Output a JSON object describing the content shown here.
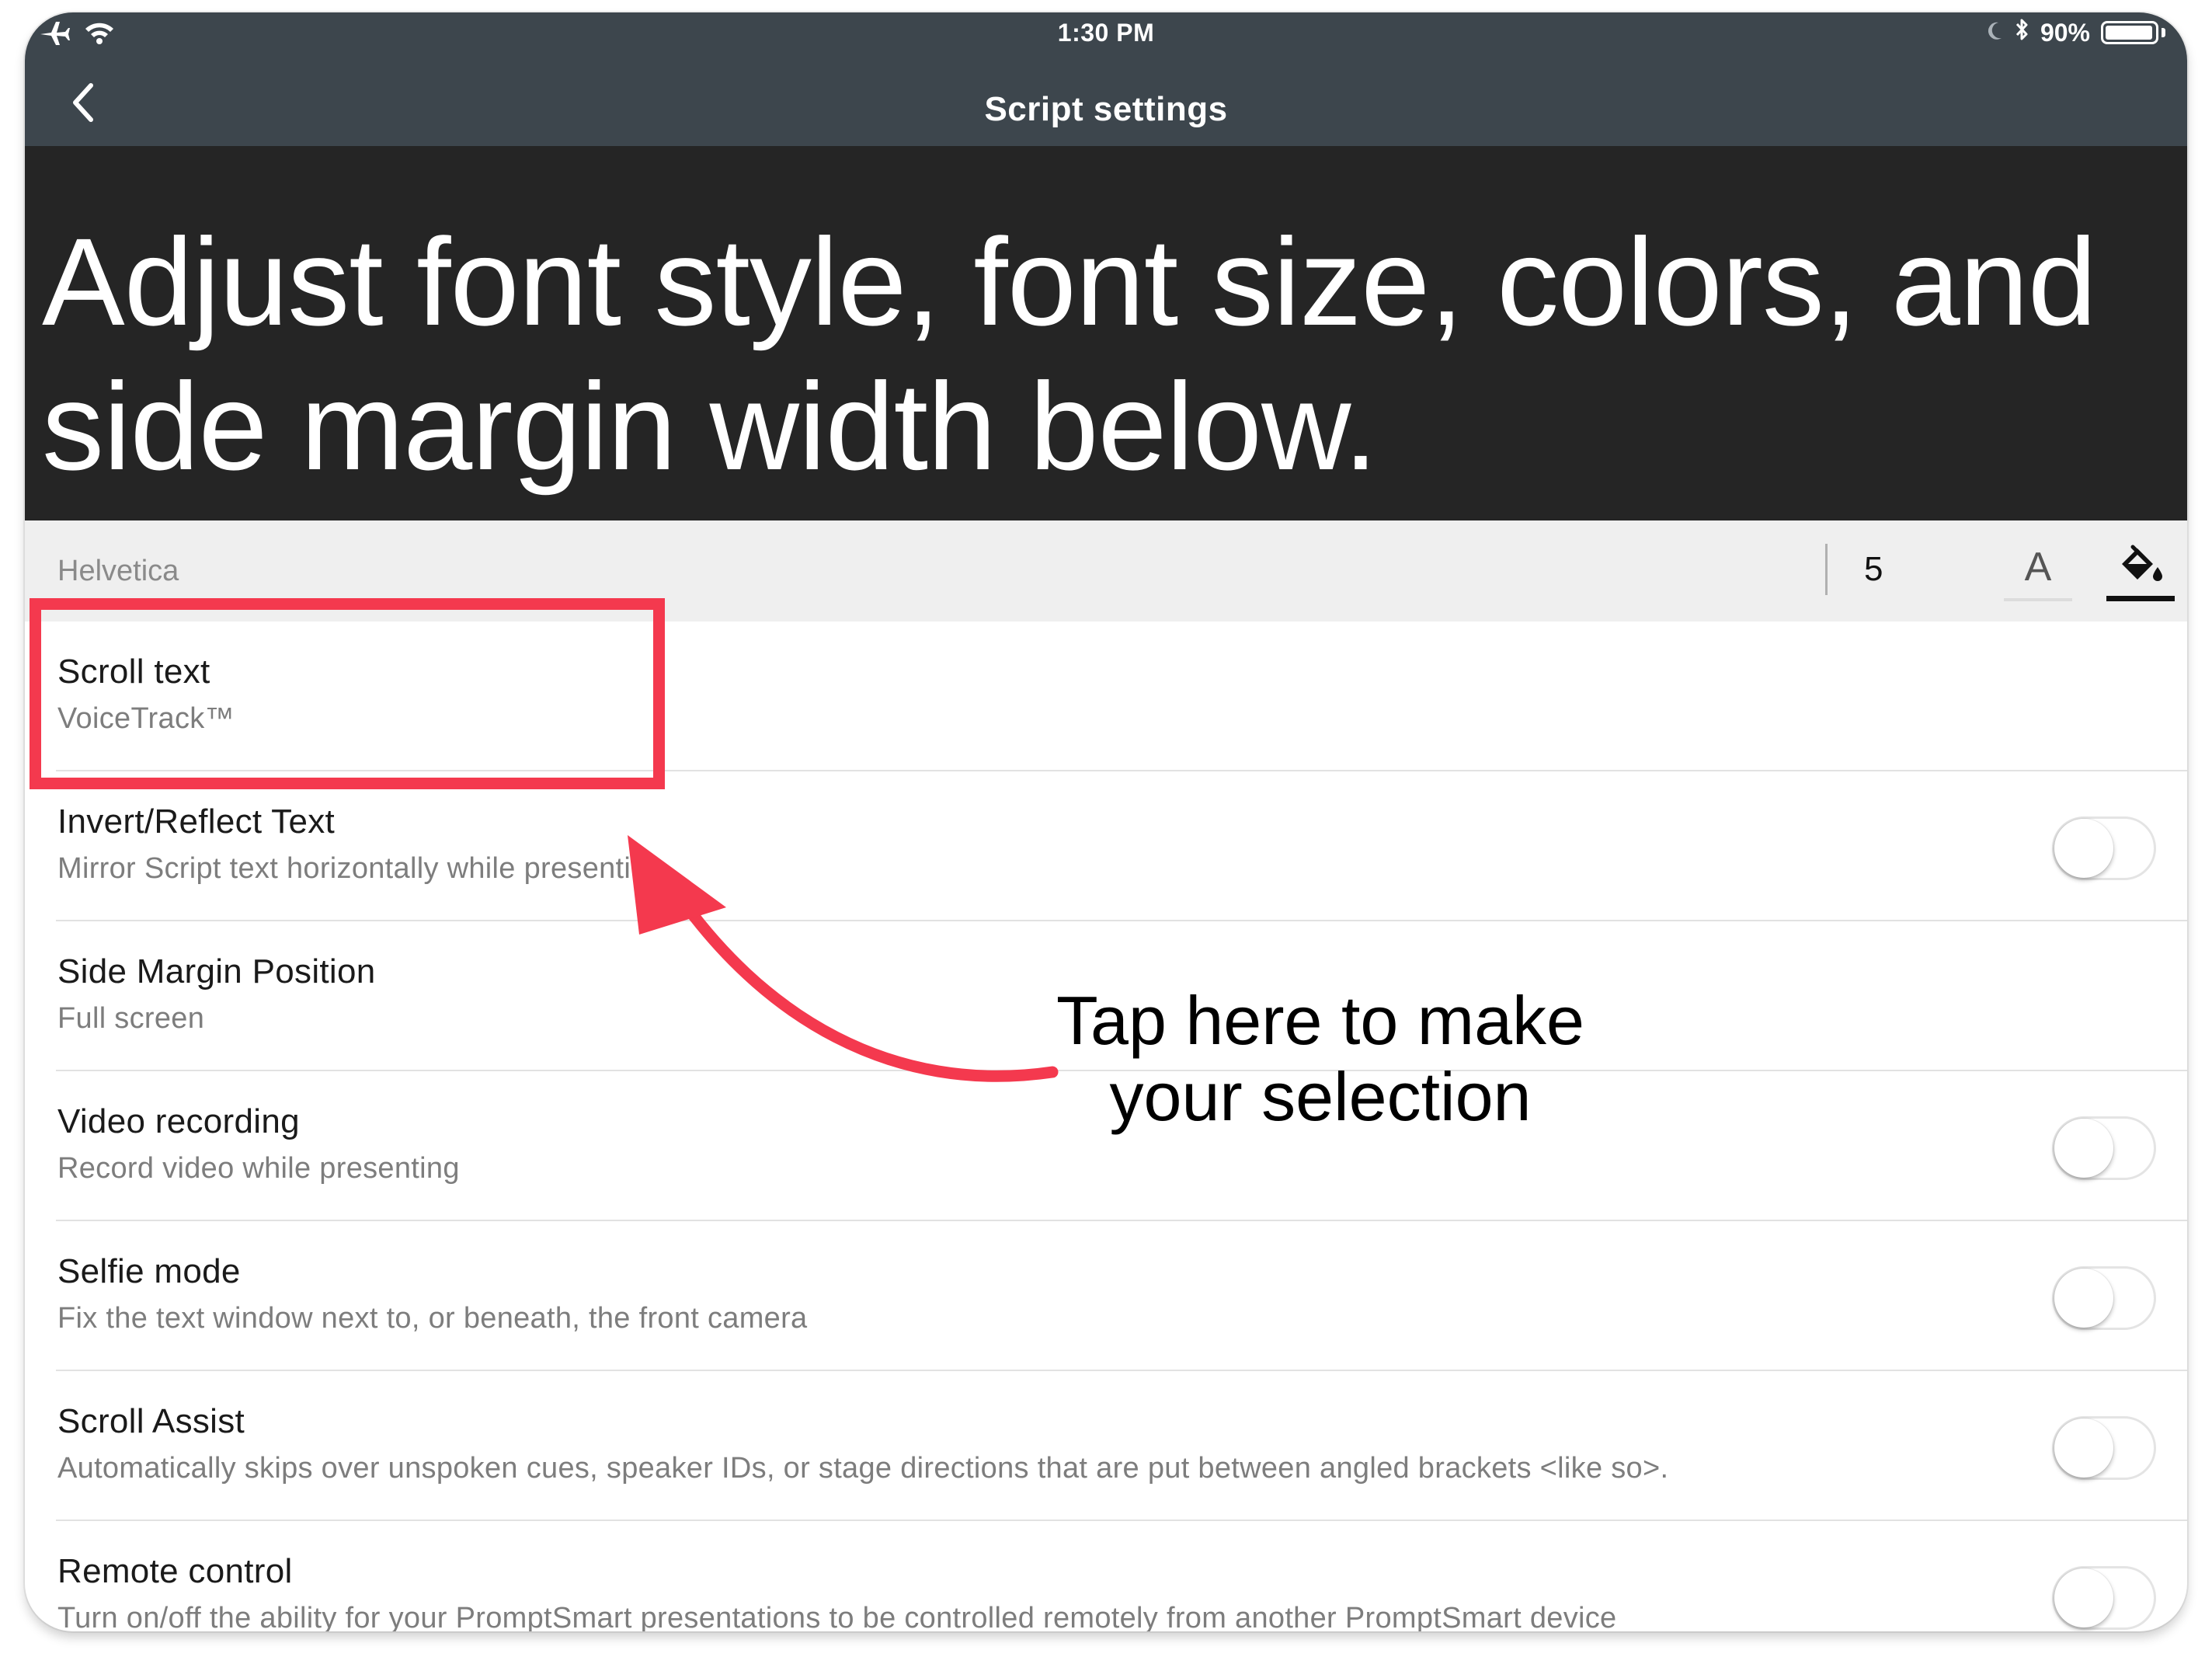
{
  "status_bar": {
    "time": "1:30 PM",
    "battery_percent": "90%",
    "icons": [
      "airplane-icon",
      "wifi-icon",
      "moon-icon",
      "bluetooth-icon",
      "battery-icon"
    ]
  },
  "nav": {
    "back_icon": "chevron-left-icon",
    "title": "Script settings"
  },
  "preview": {
    "text": "Adjust font style, font size, colors, and side margin width below."
  },
  "toolbar": {
    "font_name": "Helvetica",
    "font_size": "5",
    "text_color_label": "A",
    "fill_icon": "paint-bucket-icon"
  },
  "settings": [
    {
      "title": "Scroll text",
      "subtitle": "VoiceTrack™",
      "has_toggle": false
    },
    {
      "title": "Invert/Reflect Text",
      "subtitle": "Mirror Script text horizontally while presenting",
      "has_toggle": true,
      "on": false
    },
    {
      "title": "Side Margin Position",
      "subtitle": "Full screen",
      "has_toggle": false
    },
    {
      "title": "Video recording",
      "subtitle": "Record video while presenting",
      "has_toggle": true,
      "on": false
    },
    {
      "title": "Selfie mode",
      "subtitle": "Fix the text window next to, or beneath, the front camera",
      "has_toggle": true,
      "on": false
    },
    {
      "title": "Scroll Assist",
      "subtitle": "Automatically skips over unspoken cues, speaker IDs, or stage directions that are put between angled brackets <like so>.",
      "has_toggle": true,
      "on": false
    },
    {
      "title": "Remote control",
      "subtitle": "Turn on/off the ability for your PromptSmart presentations to be controlled remotely from another PromptSmart device",
      "has_toggle": true,
      "on": false
    }
  ],
  "annotation": {
    "line1": "Tap here to make",
    "line2": "your selection",
    "accent_color": "#f4394e"
  }
}
